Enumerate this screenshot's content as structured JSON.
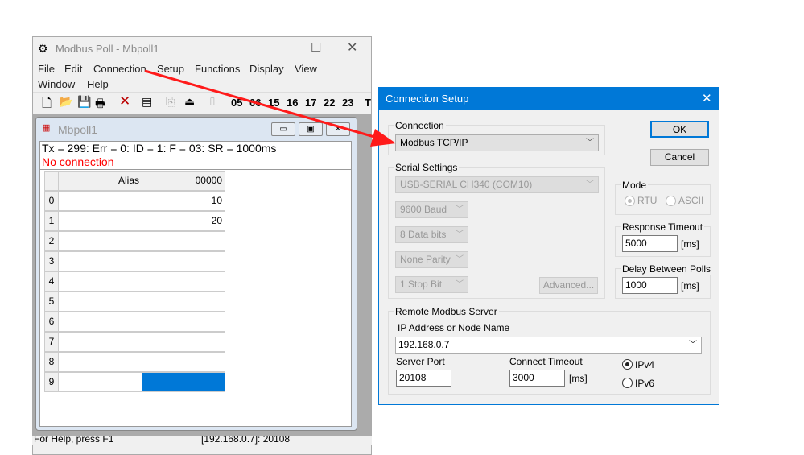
{
  "main_window": {
    "title": "Modbus Poll - Mbpoll1",
    "menu": [
      "File",
      "Edit",
      "Connection",
      "Setup",
      "Functions",
      "Display",
      "View",
      "Window",
      "Help"
    ],
    "toolbar_codes": [
      "05",
      "06",
      "15",
      "16",
      "17",
      "22",
      "23",
      "T"
    ]
  },
  "child_window": {
    "title": "Mbpoll1",
    "status_line": "Tx = 299: Err = 0: ID = 1: F = 03: SR = 1000ms",
    "connection_status": "No connection",
    "grid": {
      "headers": [
        "Alias",
        "00000"
      ],
      "rows": [
        {
          "index": "0",
          "alias": "",
          "value": "10"
        },
        {
          "index": "1",
          "alias": "",
          "value": "20"
        },
        {
          "index": "2",
          "alias": "",
          "value": ""
        },
        {
          "index": "3",
          "alias": "",
          "value": ""
        },
        {
          "index": "4",
          "alias": "",
          "value": ""
        },
        {
          "index": "5",
          "alias": "",
          "value": ""
        },
        {
          "index": "6",
          "alias": "",
          "value": ""
        },
        {
          "index": "7",
          "alias": "",
          "value": ""
        },
        {
          "index": "8",
          "alias": "",
          "value": ""
        },
        {
          "index": "9",
          "alias": "",
          "value": ""
        }
      ]
    }
  },
  "statusbar": {
    "help": "For Help, press F1",
    "connection": "[192.168.0.7]: 20108"
  },
  "dialog": {
    "title": "Connection Setup",
    "connection_label": "Connection",
    "connection_value": "Modbus TCP/IP",
    "serial_label": "Serial Settings",
    "port": "USB-SERIAL CH340 (COM10)",
    "baud": "9600 Baud",
    "data_bits": "8 Data bits",
    "parity": "None Parity",
    "stop_bits": "1 Stop Bit",
    "advanced": "Advanced...",
    "ok": "OK",
    "cancel": "Cancel",
    "mode_label": "Mode",
    "mode_rtu": "RTU",
    "mode_ascii": "ASCII",
    "response_timeout_label": "Response Timeout",
    "response_timeout": "5000",
    "ms": "[ms]",
    "delay_label": "Delay Between Polls",
    "delay": "1000",
    "remote_label": "Remote Modbus Server",
    "ip_label": "IP Address or Node Name",
    "ip": "192.168.0.7",
    "port_label": "Server Port",
    "server_port": "20108",
    "connect_timeout_label": "Connect Timeout",
    "connect_timeout": "3000",
    "ipv4": "IPv4",
    "ipv6": "IPv6"
  },
  "colors": {
    "accent": "#0078d7",
    "error": "#ff0000",
    "arrow": "#ff1a1a"
  }
}
